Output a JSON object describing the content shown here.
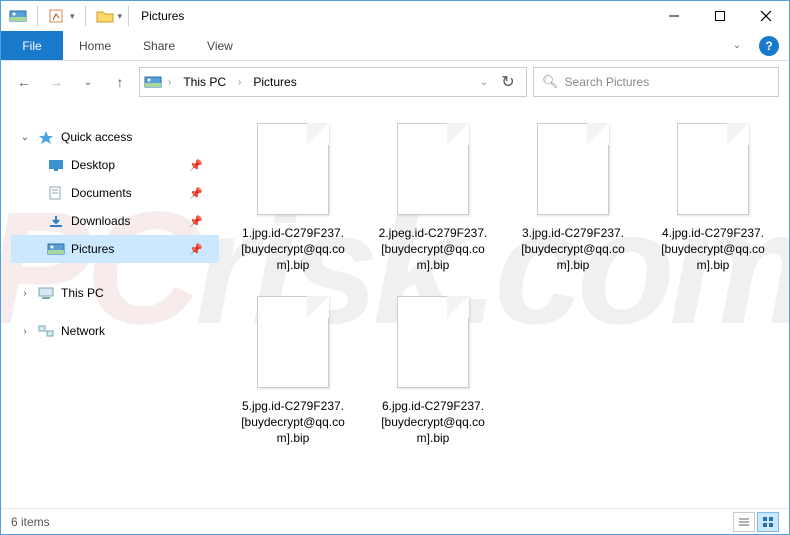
{
  "window": {
    "title": "Pictures"
  },
  "ribbon": {
    "file": "File",
    "tabs": [
      "Home",
      "Share",
      "View"
    ]
  },
  "breadcrumb": {
    "parts": [
      "This PC",
      "Pictures"
    ]
  },
  "search": {
    "placeholder": "Search Pictures"
  },
  "nav": {
    "quick_access": {
      "label": "Quick access",
      "expanded": true
    },
    "items": [
      {
        "label": "Desktop",
        "icon": "desktop",
        "pinned": true
      },
      {
        "label": "Documents",
        "icon": "documents",
        "pinned": true
      },
      {
        "label": "Downloads",
        "icon": "downloads",
        "pinned": true
      },
      {
        "label": "Pictures",
        "icon": "pictures",
        "pinned": true,
        "selected": true
      }
    ],
    "this_pc": {
      "label": "This PC",
      "expanded": false
    },
    "network": {
      "label": "Network",
      "expanded": false
    }
  },
  "files": [
    {
      "name": "1.jpg.id-C279F237.[buydecrypt@qq.com].bip"
    },
    {
      "name": "2.jpeg.id-C279F237.[buydecrypt@qq.com].bip"
    },
    {
      "name": "3.jpg.id-C279F237.[buydecrypt@qq.com].bip"
    },
    {
      "name": "4.jpg.id-C279F237.[buydecrypt@qq.com].bip"
    },
    {
      "name": "5.jpg.id-C279F237.[buydecrypt@qq.com].bip"
    },
    {
      "name": "6.jpg.id-C279F237.[buydecrypt@qq.com].bip"
    }
  ],
  "status": {
    "count": "6 items"
  },
  "colors": {
    "accent": "#1979ca",
    "selection": "#cce8ff",
    "border": "#4da0e1"
  }
}
